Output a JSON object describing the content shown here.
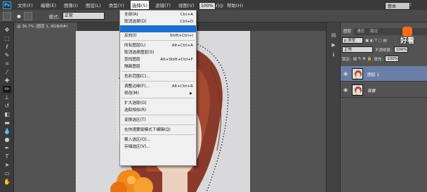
{
  "menubar": {
    "logo": "Ps",
    "items": [
      "文件(F)",
      "编辑(E)",
      "图像(I)",
      "图层(L)",
      "类型(Y)",
      "选择(S)",
      "滤镜(T)",
      "视图(V)",
      "窗口(W)",
      "帮助(H)"
    ],
    "active_index": 5
  },
  "options": {
    "mode_label": "模式:",
    "mode_value": "正常",
    "opacity_value": "100%",
    "workspace": "基本"
  },
  "document_tab": {
    "label": "@ 36.7% (图层 1, RGB/8#)"
  },
  "select_menu": {
    "items": [
      {
        "label": "全部(A)",
        "shortcut": "Ctrl+A"
      },
      {
        "label": "取消选择(D)",
        "shortcut": "Ctrl+D"
      },
      {
        "label": "",
        "shortcut": ""
      },
      {
        "label": "反向(I)",
        "shortcut": "Shift+Ctrl+I"
      },
      {
        "label": "所有图层(L)",
        "shortcut": "Alt+Ctrl+A"
      },
      {
        "label": "取消选择图层(S)",
        "shortcut": ""
      },
      {
        "label": "查找图层",
        "shortcut": "Alt+Shift+Ctrl+F"
      },
      {
        "label": "隔离图层",
        "shortcut": ""
      },
      {
        "label": "色彩范围(C)...",
        "shortcut": ""
      },
      {
        "label": "调整边缘(F)...",
        "shortcut": "Alt+Ctrl+R"
      },
      {
        "label": "修改(M)",
        "shortcut": ""
      },
      {
        "label": "扩大选取(G)",
        "shortcut": ""
      },
      {
        "label": "选取相似(R)",
        "shortcut": ""
      },
      {
        "label": "变换选区(T)",
        "shortcut": ""
      },
      {
        "label": "在快速蒙版模式下编辑(Q)",
        "shortcut": ""
      },
      {
        "label": "载入选区(O)...",
        "shortcut": ""
      },
      {
        "label": "存储选区(V)...",
        "shortcut": ""
      }
    ],
    "highlighted_index": 2
  },
  "layers_panel": {
    "tabs": [
      "图层",
      "通道",
      "路径"
    ],
    "kind_label": "p 类型",
    "blend_mode": "正常",
    "opacity_label": "不透明度:",
    "opacity_value": "100%",
    "lock_label": "锁定:",
    "fill_label": "填充:",
    "fill_value": "100%",
    "layers": [
      {
        "name": "图层 1",
        "active": true
      },
      {
        "name": "背景",
        "active": false
      }
    ]
  },
  "watermark": {
    "text": "好看"
  },
  "colors": {
    "menu_highlight": "#1d6fd0",
    "layer_active": "#6a7ea6",
    "watermark_orange": "#ff6a1a",
    "flower_orange": "#f08a1a"
  }
}
